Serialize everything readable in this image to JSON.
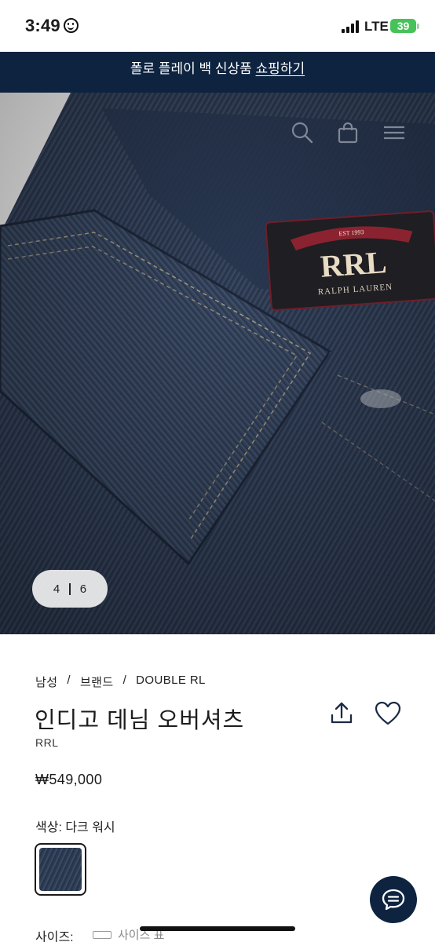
{
  "status_bar": {
    "time": "3:49",
    "network": "LTE",
    "battery": "39"
  },
  "promo": {
    "text": "폴로 플레이 백 신상품 ",
    "link": "쇼핑하기"
  },
  "hero": {
    "label_top": "EST 1993",
    "label_logo": "RRL",
    "label_brand": "RALPH LAUREN",
    "pager_current": "4",
    "pager_total": "6"
  },
  "breadcrumb": {
    "items": [
      "남성",
      "브랜드",
      "DOUBLE RL"
    ],
    "separator": "/"
  },
  "product": {
    "title": "인디고 데님 오버셔츠",
    "brand": "RRL",
    "price": "₩549,000",
    "color_label": "색상: 다크 워시",
    "size_label": "사이즈:",
    "size_guide": "사이즈 표"
  },
  "colors": {
    "navy": "#0d2340",
    "denim": "#2f3c52"
  }
}
